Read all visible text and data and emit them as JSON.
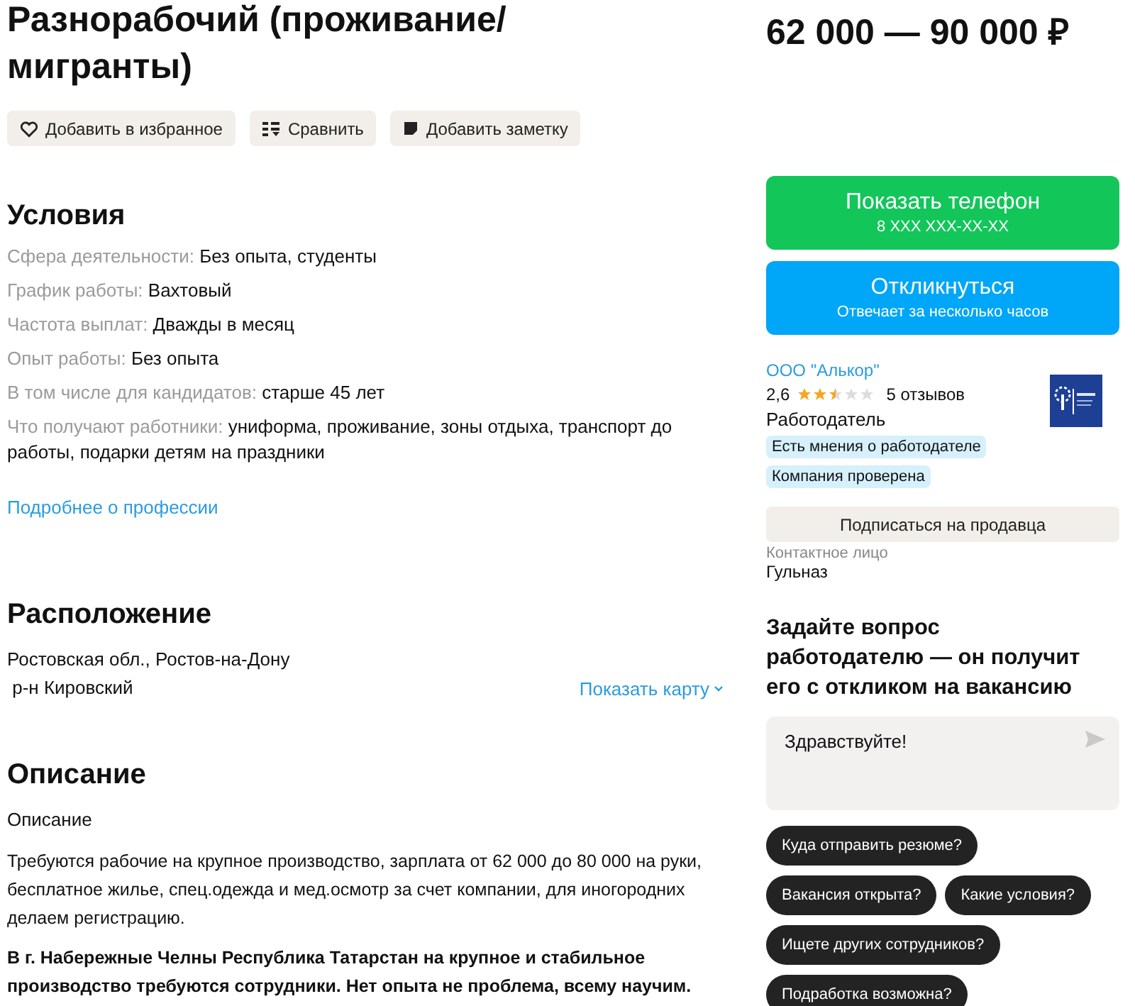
{
  "title": "Разнорабочий (проживание/ мигранты)",
  "salary": "62 000 — 90 000 ₽",
  "actions": [
    {
      "kind": "heart",
      "label": "Добавить в избранное"
    },
    {
      "kind": "compare",
      "label": "Сравнить"
    },
    {
      "kind": "note",
      "label": "Добавить заметку"
    }
  ],
  "conditions": {
    "heading": "Условия",
    "rows": [
      {
        "label": "Сфера деятельности:",
        "value": "Без опыта, студенты"
      },
      {
        "label": "График работы:",
        "value": "Вахтовый"
      },
      {
        "label": "Частота выплат:",
        "value": "Дважды в месяц"
      },
      {
        "label": "Опыт работы:",
        "value": "Без опыта"
      },
      {
        "label": "В том числе для кандидатов:",
        "value": "старше 45 лет"
      },
      {
        "label": "Что получают работники:",
        "value": "униформа, проживание, зоны отдыха, транспорт до работы, подарки детям на праздники"
      }
    ],
    "link": "Подробнее о профессии"
  },
  "location": {
    "heading": "Расположение",
    "address": "Ростовская обл., Ростов-на-Дону",
    "district": " р-н Кировский",
    "map_link": "Показать карту"
  },
  "description": {
    "heading": "Описание",
    "subheading": "Описание",
    "paragraphs": [
      {
        "kind": "plain",
        "text": "Требуются рабочие на крупное производство, зарплата от 62 000 до 80 000 на руки, бесплатное жилье, спец.одежда и мед.осмотр за счет компании, для иногородних делаем регистрацию."
      },
      {
        "kind": "bold",
        "text": "В г. Набережные Челны Республика Татарстан на крупное и стабильное производство требуются сотрудники. Нет опыта не проблема, всему научим."
      }
    ]
  },
  "phone_button": {
    "label": "Показать телефон",
    "sub": "8 XXX XXX-XX-XX"
  },
  "respond_button": {
    "label": "Откликнуться",
    "sub": "Отвечает за несколько часов"
  },
  "employer": {
    "name": "ООО \"Алькор\"",
    "rating": "2,6",
    "stars": 2.5,
    "reviews": "5 отзывов",
    "role": "Работодатель",
    "badges": [
      "Есть мнения о работодателе",
      "Компания проверена"
    ],
    "subscribe": "Подписаться на продавца",
    "contact_label": "Контактное лицо",
    "contact_name": "Гульназ"
  },
  "question": {
    "heading": "Задайте вопрос работодателю — он получит его с откликом на вакансию",
    "value": "Здравствуйте!",
    "chips": [
      "Куда отправить резюме?",
      "Вакансия открыта?",
      "Какие условия?",
      "Ищете других сотрудников?",
      "Подработка возможна?"
    ]
  }
}
